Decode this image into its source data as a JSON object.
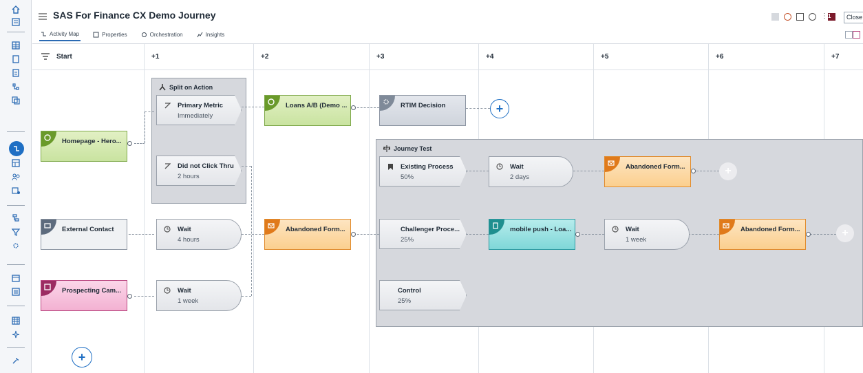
{
  "header": {
    "title": "SAS For Finance CX Demo Journey",
    "close_label": "Close",
    "notification_count": "1",
    "tabs": [
      {
        "label": "Activity Map",
        "icon": "activity-map-icon"
      },
      {
        "label": "Properties",
        "icon": "properties-icon"
      },
      {
        "label": "Orchestration",
        "icon": "orchestration-icon"
      },
      {
        "label": "Insights",
        "icon": "insights-icon"
      }
    ]
  },
  "columns": [
    "Start",
    "+1",
    "+2",
    "+3",
    "+4",
    "+5",
    "+6",
    "+7"
  ],
  "groups": {
    "split": "Split on Action",
    "journey_test": "Journey Test"
  },
  "nodes": {
    "homepage": {
      "title": "Homepage - Hero..."
    },
    "external": {
      "title": "External Contact"
    },
    "prospecting": {
      "title": "Prospecting Cam..."
    },
    "primary_metric": {
      "title": "Primary Metric",
      "sub": "Immediately"
    },
    "did_not_click": {
      "title": "Did not Click Thru",
      "sub": "2 hours"
    },
    "wait_4h": {
      "title": "Wait",
      "sub": "4 hours"
    },
    "wait_1w": {
      "title": "Wait",
      "sub": "1 week"
    },
    "loans_ab": {
      "title": "Loans A/B (Demo ..."
    },
    "abandoned_1": {
      "title": "Abandoned Form..."
    },
    "rtim": {
      "title": "RTIM Decision"
    },
    "existing": {
      "title": "Existing Process",
      "sub": "50%"
    },
    "challenger": {
      "title": "Challenger Proce...",
      "sub": "25%"
    },
    "control": {
      "title": "Control",
      "sub": "25%"
    },
    "wait_2d": {
      "title": "Wait",
      "sub": "2 days"
    },
    "mobile_push": {
      "title": "mobile push - Loa..."
    },
    "abandoned_2": {
      "title": "Abandoned Form..."
    },
    "wait_1w_b": {
      "title": "Wait",
      "sub": "1 week"
    },
    "abandoned_3": {
      "title": "Abandoned Form..."
    }
  },
  "colors": {
    "accent": "#1f6fc4",
    "green": "#6a9a2a",
    "orange": "#e07a1b",
    "pink": "#9c2c62",
    "teal": "#1f8f8f",
    "gray_icon": "#5d6b7d"
  }
}
